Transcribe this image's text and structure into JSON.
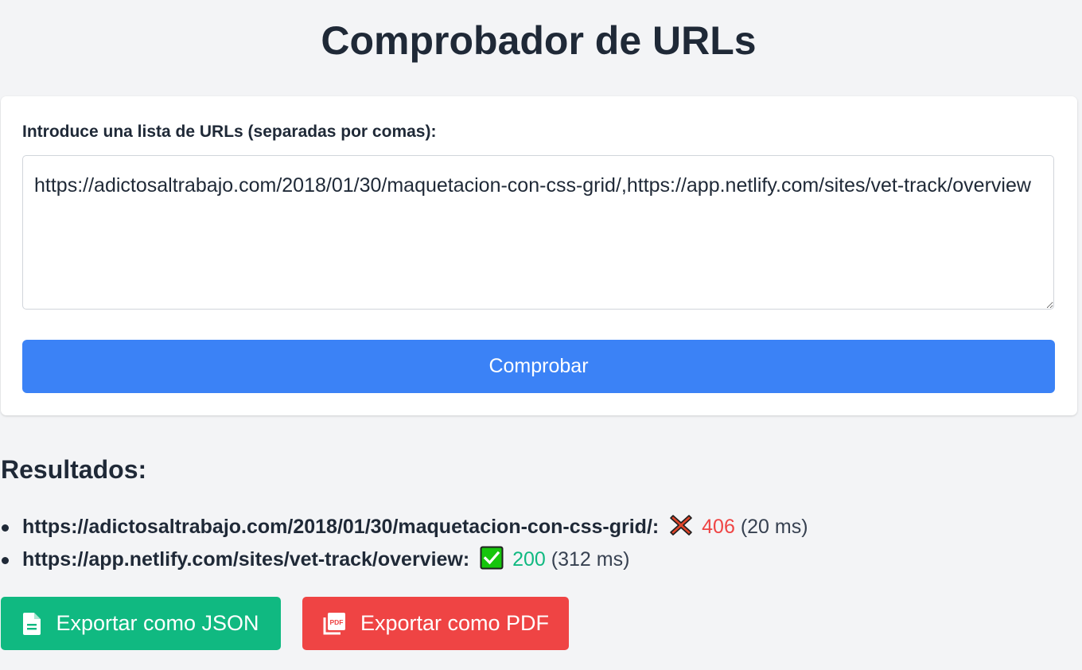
{
  "page": {
    "title": "Comprobador de URLs"
  },
  "form": {
    "label": "Introduce una lista de URLs (separadas por comas):",
    "textarea_value": "https://adictosaltrabajo.com/2018/01/30/maquetacion-con-css-grid/,https://app.netlify.com/sites/vet-track/overview",
    "submit_label": "Comprobar"
  },
  "results": {
    "heading": "Resultados:",
    "items": [
      {
        "url": "https://adictosaltrabajo.com/2018/01/30/maquetacion-con-css-grid/:",
        "status_icon": "cross-mark-icon",
        "code": "406",
        "time": "(20 ms)"
      },
      {
        "url": "https://app.netlify.com/sites/vet-track/overview:",
        "status_icon": "check-mark-icon",
        "code": "200",
        "time": "(312 ms)"
      }
    ]
  },
  "export": {
    "json_label": "Exportar como JSON",
    "json_icon": "document-icon",
    "pdf_label": "Exportar como PDF",
    "pdf_icon": "pdf-icon"
  },
  "colors": {
    "primary": "#3b82f6",
    "success": "#10b981",
    "danger": "#ef4444",
    "text": "#1f2937",
    "background": "#f3f4f6"
  }
}
